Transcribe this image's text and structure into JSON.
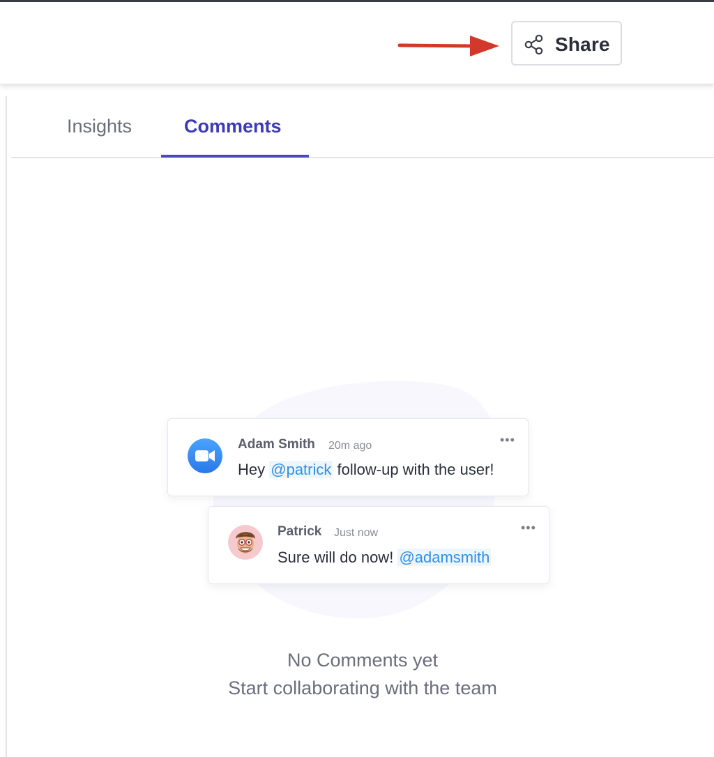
{
  "header": {
    "share_label": "Share",
    "share_icon": "share-icon",
    "arrow_color": "#d13a2a"
  },
  "tabs": [
    {
      "label": "Insights",
      "active": false
    },
    {
      "label": "Comments",
      "active": true
    }
  ],
  "comments": [
    {
      "author": "Adam Smith",
      "time": "20m ago",
      "avatar": "zoom-avatar",
      "text_before": "Hey",
      "mention": "@patrick",
      "text_after": "follow-up with the user!",
      "menu": "•••"
    },
    {
      "author": "Patrick",
      "time": "Just now",
      "avatar": "memoji-avatar",
      "text_before": "Sure will do now!",
      "mention": "@adamsmith",
      "text_after": "",
      "menu": "•••"
    }
  ],
  "empty_state": {
    "title": "No Comments yet",
    "subtitle": "Start collaborating with the team"
  },
  "colors": {
    "accent": "#4c46c9",
    "mention": "#2f8fe6",
    "zoom_blue": "#2d8cff"
  }
}
